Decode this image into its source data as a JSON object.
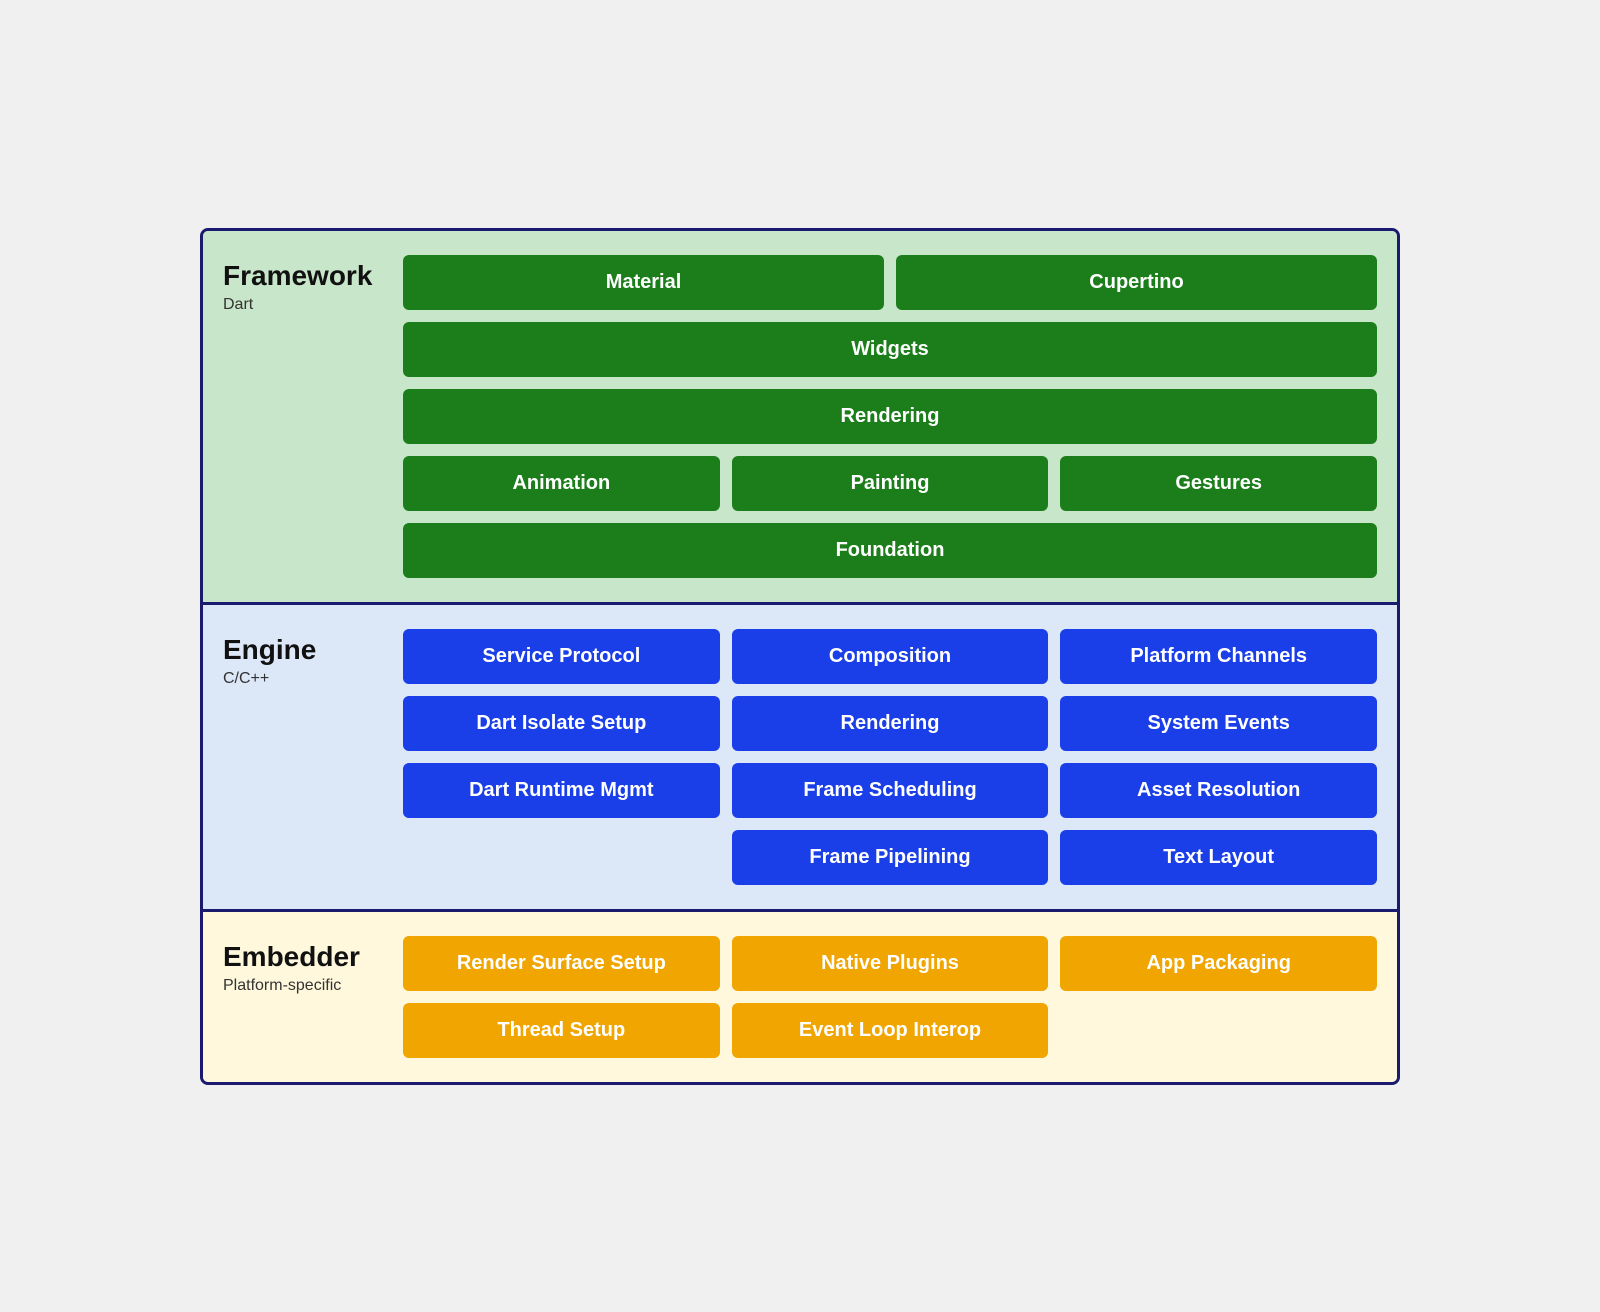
{
  "framework": {
    "title": "Framework",
    "subtitle": "Dart",
    "rows": [
      [
        {
          "label": "Material",
          "flex": 1
        },
        {
          "label": "Cupertino",
          "flex": 1
        }
      ],
      [
        {
          "label": "Widgets",
          "flex": 1
        }
      ],
      [
        {
          "label": "Rendering",
          "flex": 1
        }
      ],
      [
        {
          "label": "Animation",
          "flex": 1
        },
        {
          "label": "Painting",
          "flex": 1
        },
        {
          "label": "Gestures",
          "flex": 1
        }
      ],
      [
        {
          "label": "Foundation",
          "flex": 1
        }
      ]
    ]
  },
  "engine": {
    "title": "Engine",
    "subtitle": "C/C++",
    "rows": [
      [
        {
          "label": "Service Protocol",
          "flex": 1
        },
        {
          "label": "Composition",
          "flex": 1
        },
        {
          "label": "Platform Channels",
          "flex": 1
        }
      ],
      [
        {
          "label": "Dart Isolate Setup",
          "flex": 1
        },
        {
          "label": "Rendering",
          "flex": 1
        },
        {
          "label": "System Events",
          "flex": 1
        }
      ],
      [
        {
          "label": "Dart Runtime Mgmt",
          "flex": 1
        },
        {
          "label": "Frame Scheduling",
          "flex": 1
        },
        {
          "label": "Asset Resolution",
          "flex": 1
        }
      ],
      [
        {
          "label": "",
          "flex": 1,
          "empty": true
        },
        {
          "label": "Frame Pipelining",
          "flex": 1
        },
        {
          "label": "Text Layout",
          "flex": 1
        }
      ]
    ]
  },
  "embedder": {
    "title": "Embedder",
    "subtitle": "Platform-specific",
    "rows": [
      [
        {
          "label": "Render Surface Setup",
          "flex": 1
        },
        {
          "label": "Native Plugins",
          "flex": 1
        },
        {
          "label": "App Packaging",
          "flex": 1
        }
      ],
      [
        {
          "label": "Thread Setup",
          "flex": 1
        },
        {
          "label": "Event Loop Interop",
          "flex": 1
        },
        {
          "label": "",
          "flex": 1,
          "empty": true
        }
      ]
    ]
  }
}
